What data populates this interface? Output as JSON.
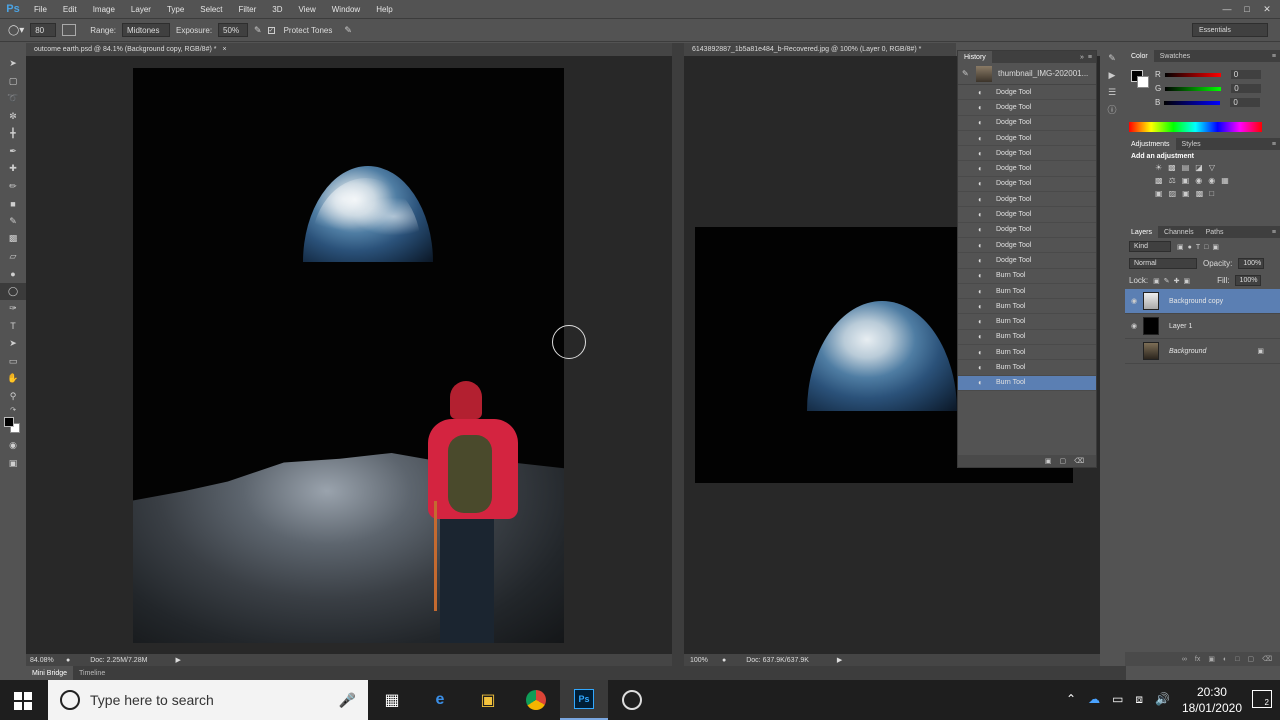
{
  "app": {
    "logo": "Ps"
  },
  "menu": [
    "File",
    "Edit",
    "Image",
    "Layer",
    "Type",
    "Select",
    "Filter",
    "3D",
    "View",
    "Window",
    "Help"
  ],
  "options": {
    "brush_size": "80",
    "range_label": "Range:",
    "range_value": "Midtones",
    "exposure_label": "Exposure:",
    "exposure_value": "50%",
    "protect_tones_label": "Protect Tones",
    "workspace": "Essentials"
  },
  "doc1": {
    "title": "outcome earth.psd @ 84.1% (Background copy, RGB/8#) *",
    "zoom": "84.08%",
    "doc_size": "Doc: 2.25M/7.28M"
  },
  "doc2": {
    "title": "6143892887_1b5a81e484_b-Recovered.jpg @ 100% (Layer 0, RGB/8#) *",
    "zoom": "100%",
    "doc_size": "Doc: 637.9K/637.9K"
  },
  "history": {
    "tab": "History",
    "snapshot": "thumbnail_IMG-202001...",
    "items": [
      "Dodge Tool",
      "Dodge Tool",
      "Dodge Tool",
      "Dodge Tool",
      "Dodge Tool",
      "Dodge Tool",
      "Dodge Tool",
      "Dodge Tool",
      "Dodge Tool",
      "Dodge Tool",
      "Dodge Tool",
      "Dodge Tool",
      "Burn Tool",
      "Burn Tool",
      "Burn Tool",
      "Burn Tool",
      "Burn Tool",
      "Burn Tool",
      "Burn Tool",
      "Burn Tool"
    ]
  },
  "color_panel": {
    "tabs": [
      "Color",
      "Swatches"
    ],
    "r_label": "R",
    "g_label": "G",
    "b_label": "B",
    "r": "0",
    "g": "0",
    "b": "0"
  },
  "adjustments": {
    "tabs": [
      "Adjustments",
      "Styles"
    ],
    "heading": "Add an adjustment"
  },
  "layers": {
    "tabs": [
      "Layers",
      "Channels",
      "Paths"
    ],
    "kind": "Kind",
    "blend_mode": "Normal",
    "opacity_label": "Opacity:",
    "opacity": "100%",
    "lock_label": "Lock:",
    "fill_label": "Fill:",
    "fill": "100%",
    "items": [
      "Background copy",
      "Layer 1",
      "Background"
    ]
  },
  "bottom_tabs": [
    "Mini Bridge",
    "Timeline"
  ],
  "taskbar": {
    "search_placeholder": "Type here to search",
    "time": "20:30",
    "date": "18/01/2020",
    "notifications": "2"
  }
}
